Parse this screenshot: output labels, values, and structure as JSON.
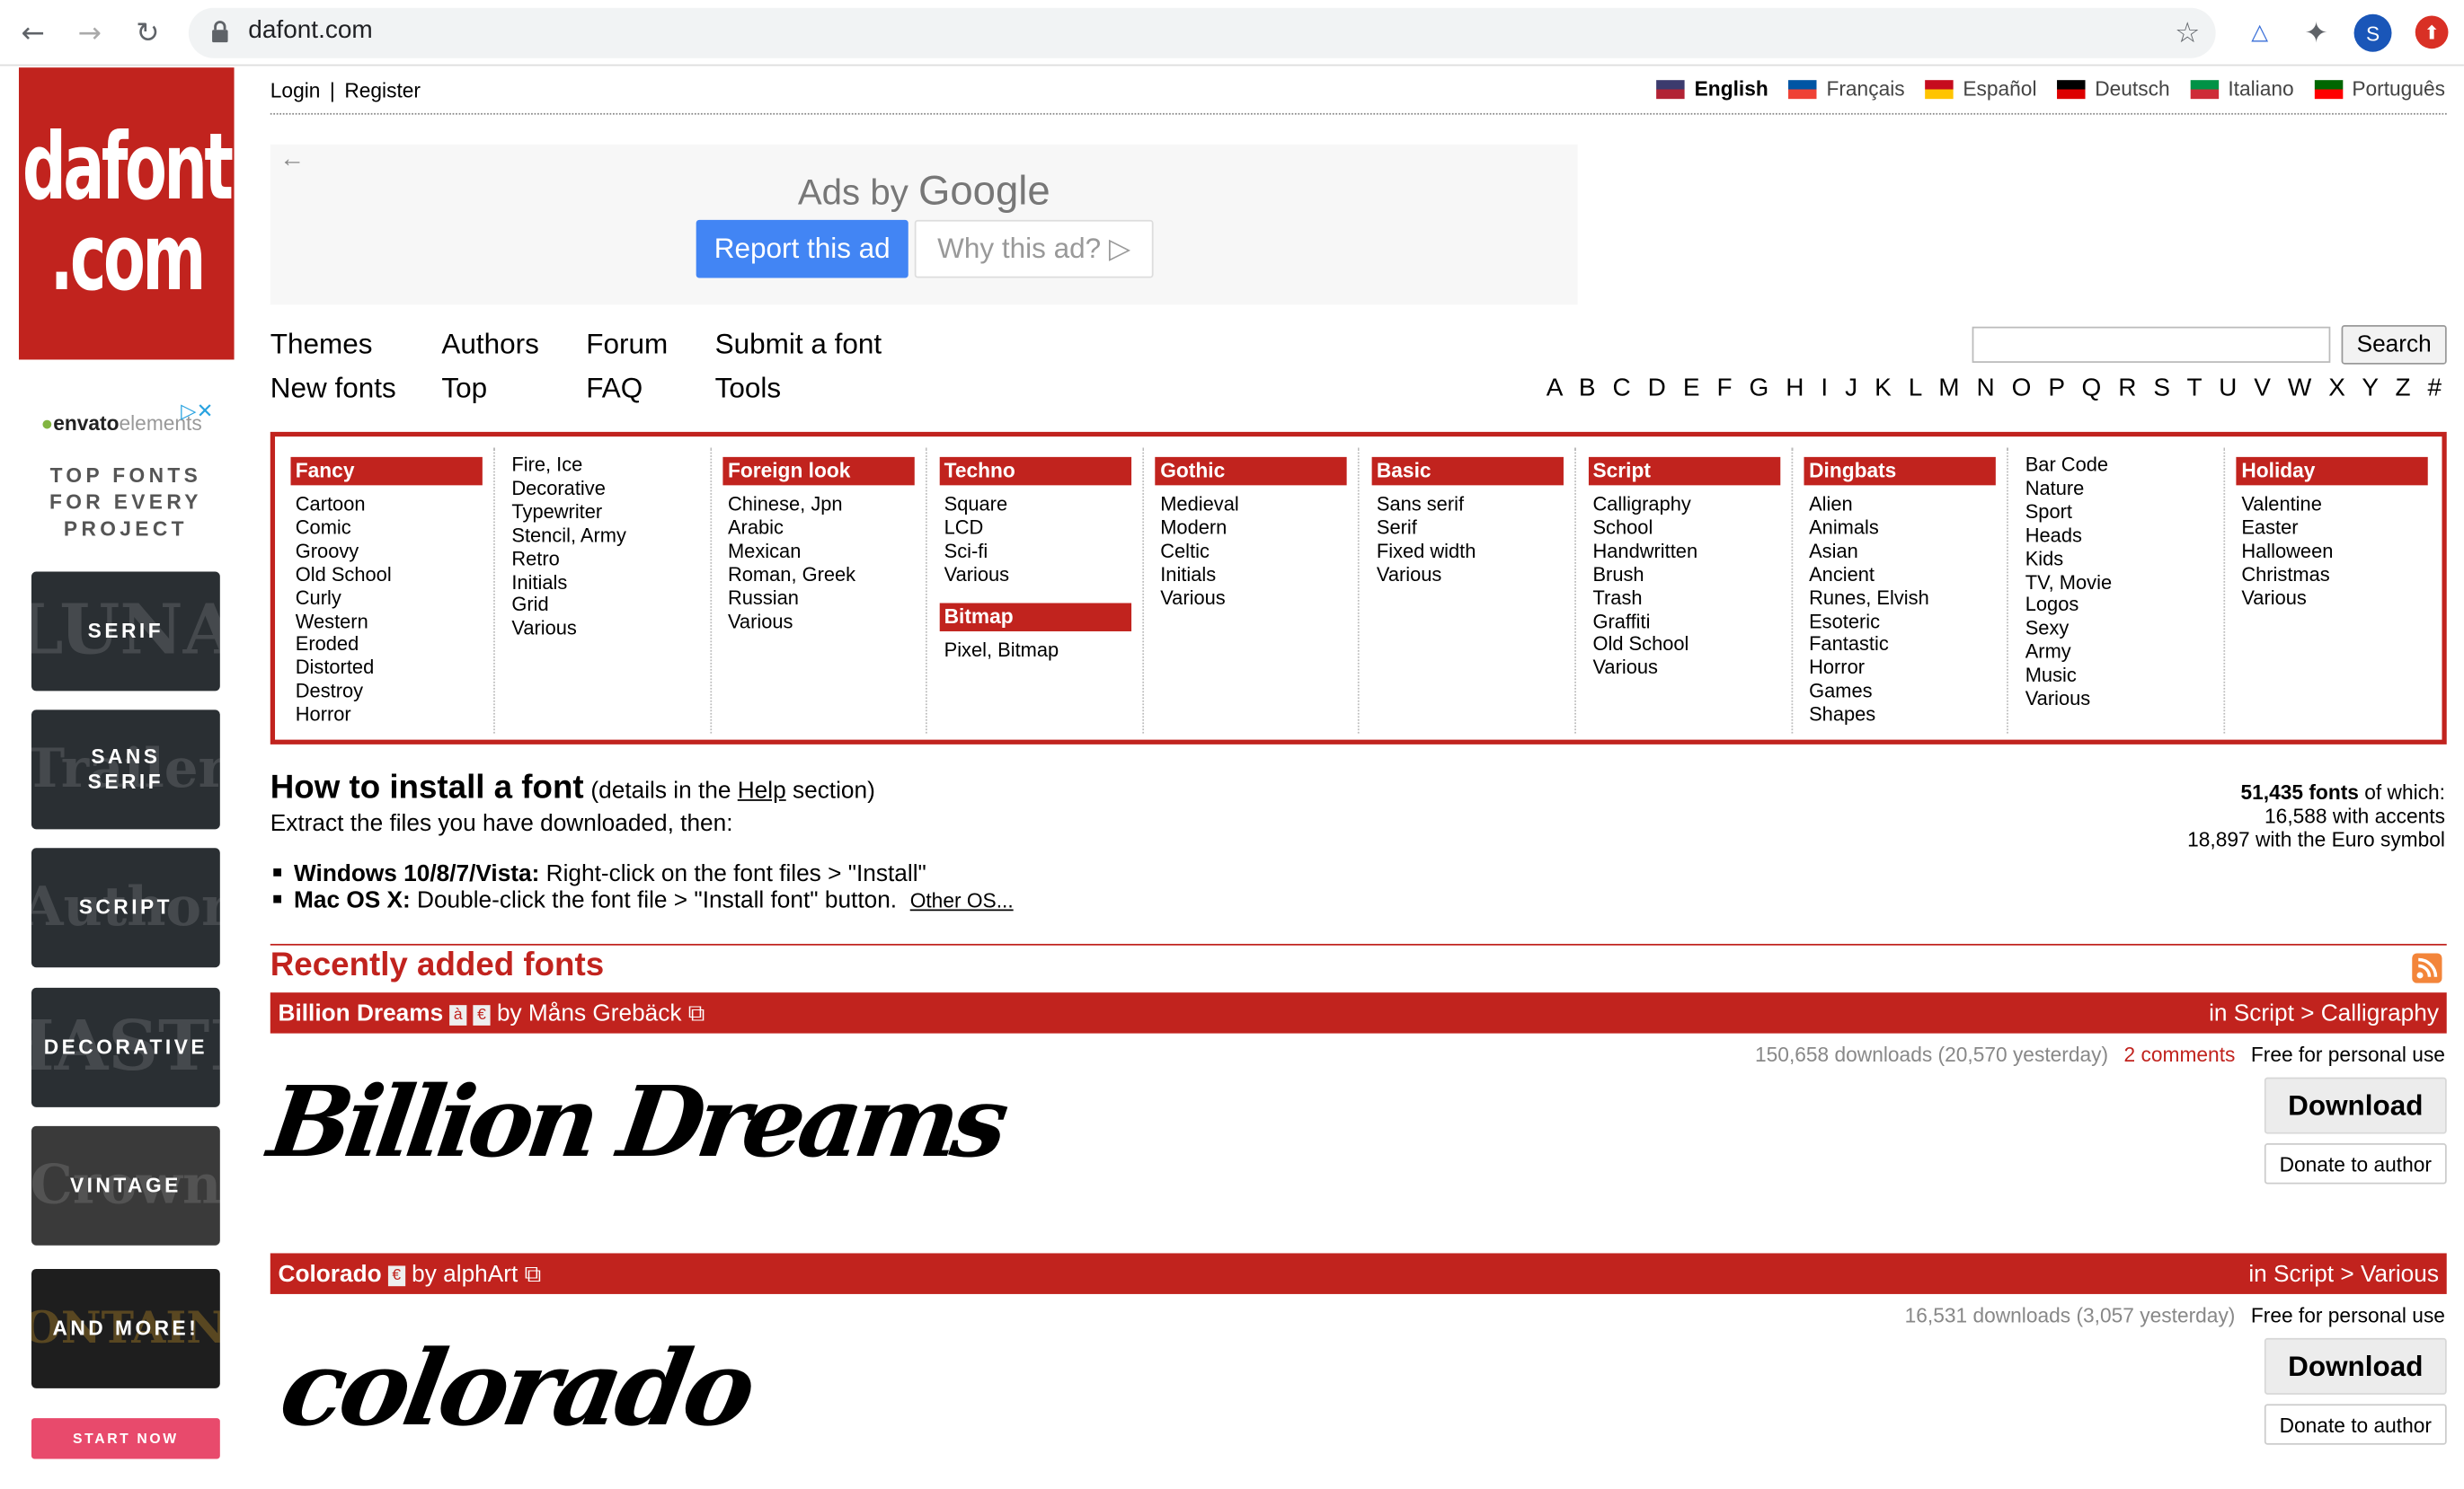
{
  "browser": {
    "url": "dafont.com",
    "profile_initial": "S"
  },
  "logo": {
    "line1": "dafont",
    "line2": ".com"
  },
  "sidebar": {
    "envato": "envato",
    "envato2": "elements",
    "tagline": "TOP FONTS FOR EVERY PROJECT",
    "tiles": [
      {
        "label": "SERIF",
        "bg": "LUNA"
      },
      {
        "label": "SANS SERIF",
        "bg": "Trailer"
      },
      {
        "label": "SCRIPT",
        "bg": "Author"
      },
      {
        "label": "DECORATIVE",
        "bg": "HASTE"
      },
      {
        "label": "VINTAGE",
        "bg": "Crown"
      },
      {
        "label": "AND MORE!",
        "bg": "FONTAINE"
      }
    ],
    "start": "START NOW"
  },
  "header": {
    "login": "Login",
    "sep": "|",
    "register": "Register",
    "languages": [
      {
        "label": "English",
        "active": true,
        "c1": "#3c3b6e",
        "c2": "#b22234"
      },
      {
        "label": "Français",
        "active": false,
        "c1": "#0055a4",
        "c2": "#ef4135"
      },
      {
        "label": "Español",
        "active": false,
        "c1": "#c60b1e",
        "c2": "#ffc400"
      },
      {
        "label": "Deutsch",
        "active": false,
        "c1": "#000000",
        "c2": "#dd0000"
      },
      {
        "label": "Italiano",
        "active": false,
        "c1": "#009246",
        "c2": "#ce2b37"
      },
      {
        "label": "Português",
        "active": false,
        "c1": "#006600",
        "c2": "#ff0000"
      }
    ]
  },
  "ad": {
    "ads_by": "Ads by",
    "google": "Google",
    "report": "Report this ad",
    "why": "Why this ad?"
  },
  "nav": {
    "themes": "Themes",
    "authors": "Authors",
    "forum": "Forum",
    "submit": "Submit a font",
    "new_fonts": "New fonts",
    "top": "Top",
    "faq": "FAQ",
    "tools": "Tools",
    "search": "Search",
    "alphabet": "A B C D E F G H I J K L M N O P Q R S T U V W X Y Z #"
  },
  "categories": [
    {
      "groups": [
        {
          "title": "Fancy",
          "items": [
            "Cartoon",
            "Comic",
            "Groovy",
            "Old School",
            "Curly",
            "Western",
            "Eroded",
            "Distorted",
            "Destroy",
            "Horror"
          ]
        }
      ]
    },
    {
      "groups": [
        {
          "title": "",
          "items": [
            "Fire, Ice",
            "Decorative",
            "Typewriter",
            "Stencil, Army",
            "Retro",
            "Initials",
            "Grid",
            "Various"
          ]
        }
      ]
    },
    {
      "groups": [
        {
          "title": "Foreign look",
          "items": [
            "Chinese, Jpn",
            "Arabic",
            "Mexican",
            "Roman, Greek",
            "Russian",
            "Various"
          ]
        }
      ]
    },
    {
      "groups": [
        {
          "title": "Techno",
          "items": [
            "Square",
            "LCD",
            "Sci-fi",
            "Various"
          ]
        },
        {
          "title": "Bitmap",
          "items": [
            "Pixel, Bitmap"
          ]
        }
      ]
    },
    {
      "groups": [
        {
          "title": "Gothic",
          "items": [
            "Medieval",
            "Modern",
            "Celtic",
            "Initials",
            "Various"
          ]
        }
      ]
    },
    {
      "groups": [
        {
          "title": "Basic",
          "items": [
            "Sans serif",
            "Serif",
            "Fixed width",
            "Various"
          ]
        }
      ]
    },
    {
      "groups": [
        {
          "title": "Script",
          "items": [
            "Calligraphy",
            "School",
            "Handwritten",
            "Brush",
            "Trash",
            "Graffiti",
            "Old School",
            "Various"
          ]
        }
      ]
    },
    {
      "groups": [
        {
          "title": "Dingbats",
          "items": [
            "Alien",
            "Animals",
            "Asian",
            "Ancient",
            "Runes, Elvish",
            "Esoteric",
            "Fantastic",
            "Horror",
            "Games",
            "Shapes"
          ]
        }
      ]
    },
    {
      "groups": [
        {
          "title": "",
          "items": [
            "Bar Code",
            "Nature",
            "Sport",
            "Heads",
            "Kids",
            "TV, Movie",
            "Logos",
            "Sexy",
            "Army",
            "Music",
            "Various"
          ]
        }
      ]
    },
    {
      "groups": [
        {
          "title": "Holiday",
          "items": [
            "Valentine",
            "Easter",
            "Halloween",
            "Christmas",
            "Various"
          ]
        }
      ]
    }
  ],
  "howto": {
    "title": "How to install a font",
    "details_pre": "(details in the ",
    "help": "Help",
    "details_post": " section)",
    "extract": "Extract the files you have downloaded, then:",
    "win_b": "Windows 10/8/7/Vista:",
    "win_t": " Right-click on the font files > \"Install\"",
    "mac_b": "Mac OS X:",
    "mac_t": " Double-click the font file > \"Install font\" button.",
    "other": "Other OS..."
  },
  "stats": {
    "count": "51,435 fonts",
    "of_which": " of which:",
    "accents": "16,588 with accents",
    "euro": "18,897 with the Euro symbol"
  },
  "recent": {
    "title": "Recently added fonts"
  },
  "fonts": [
    {
      "name": "Billion Dreams",
      "badge1": "à",
      "badge2": "€",
      "by": "by Måns Grebäck",
      "category": "in Script > Calligraphy",
      "downloads": "150,658 downloads (20,570 yesterday)",
      "comments": "2 comments",
      "license": "Free for personal use",
      "download": "Download",
      "donate": "Donate to author",
      "preview": "Billion Dreams"
    },
    {
      "name": "Colorado",
      "badge1": "€",
      "by": "by alphArt",
      "category": "in Script > Various",
      "downloads": "16,531 downloads (3,057 yesterday)",
      "license": "Free for personal use",
      "download": "Download",
      "donate": "Donate to author",
      "preview": "colorado"
    }
  ]
}
